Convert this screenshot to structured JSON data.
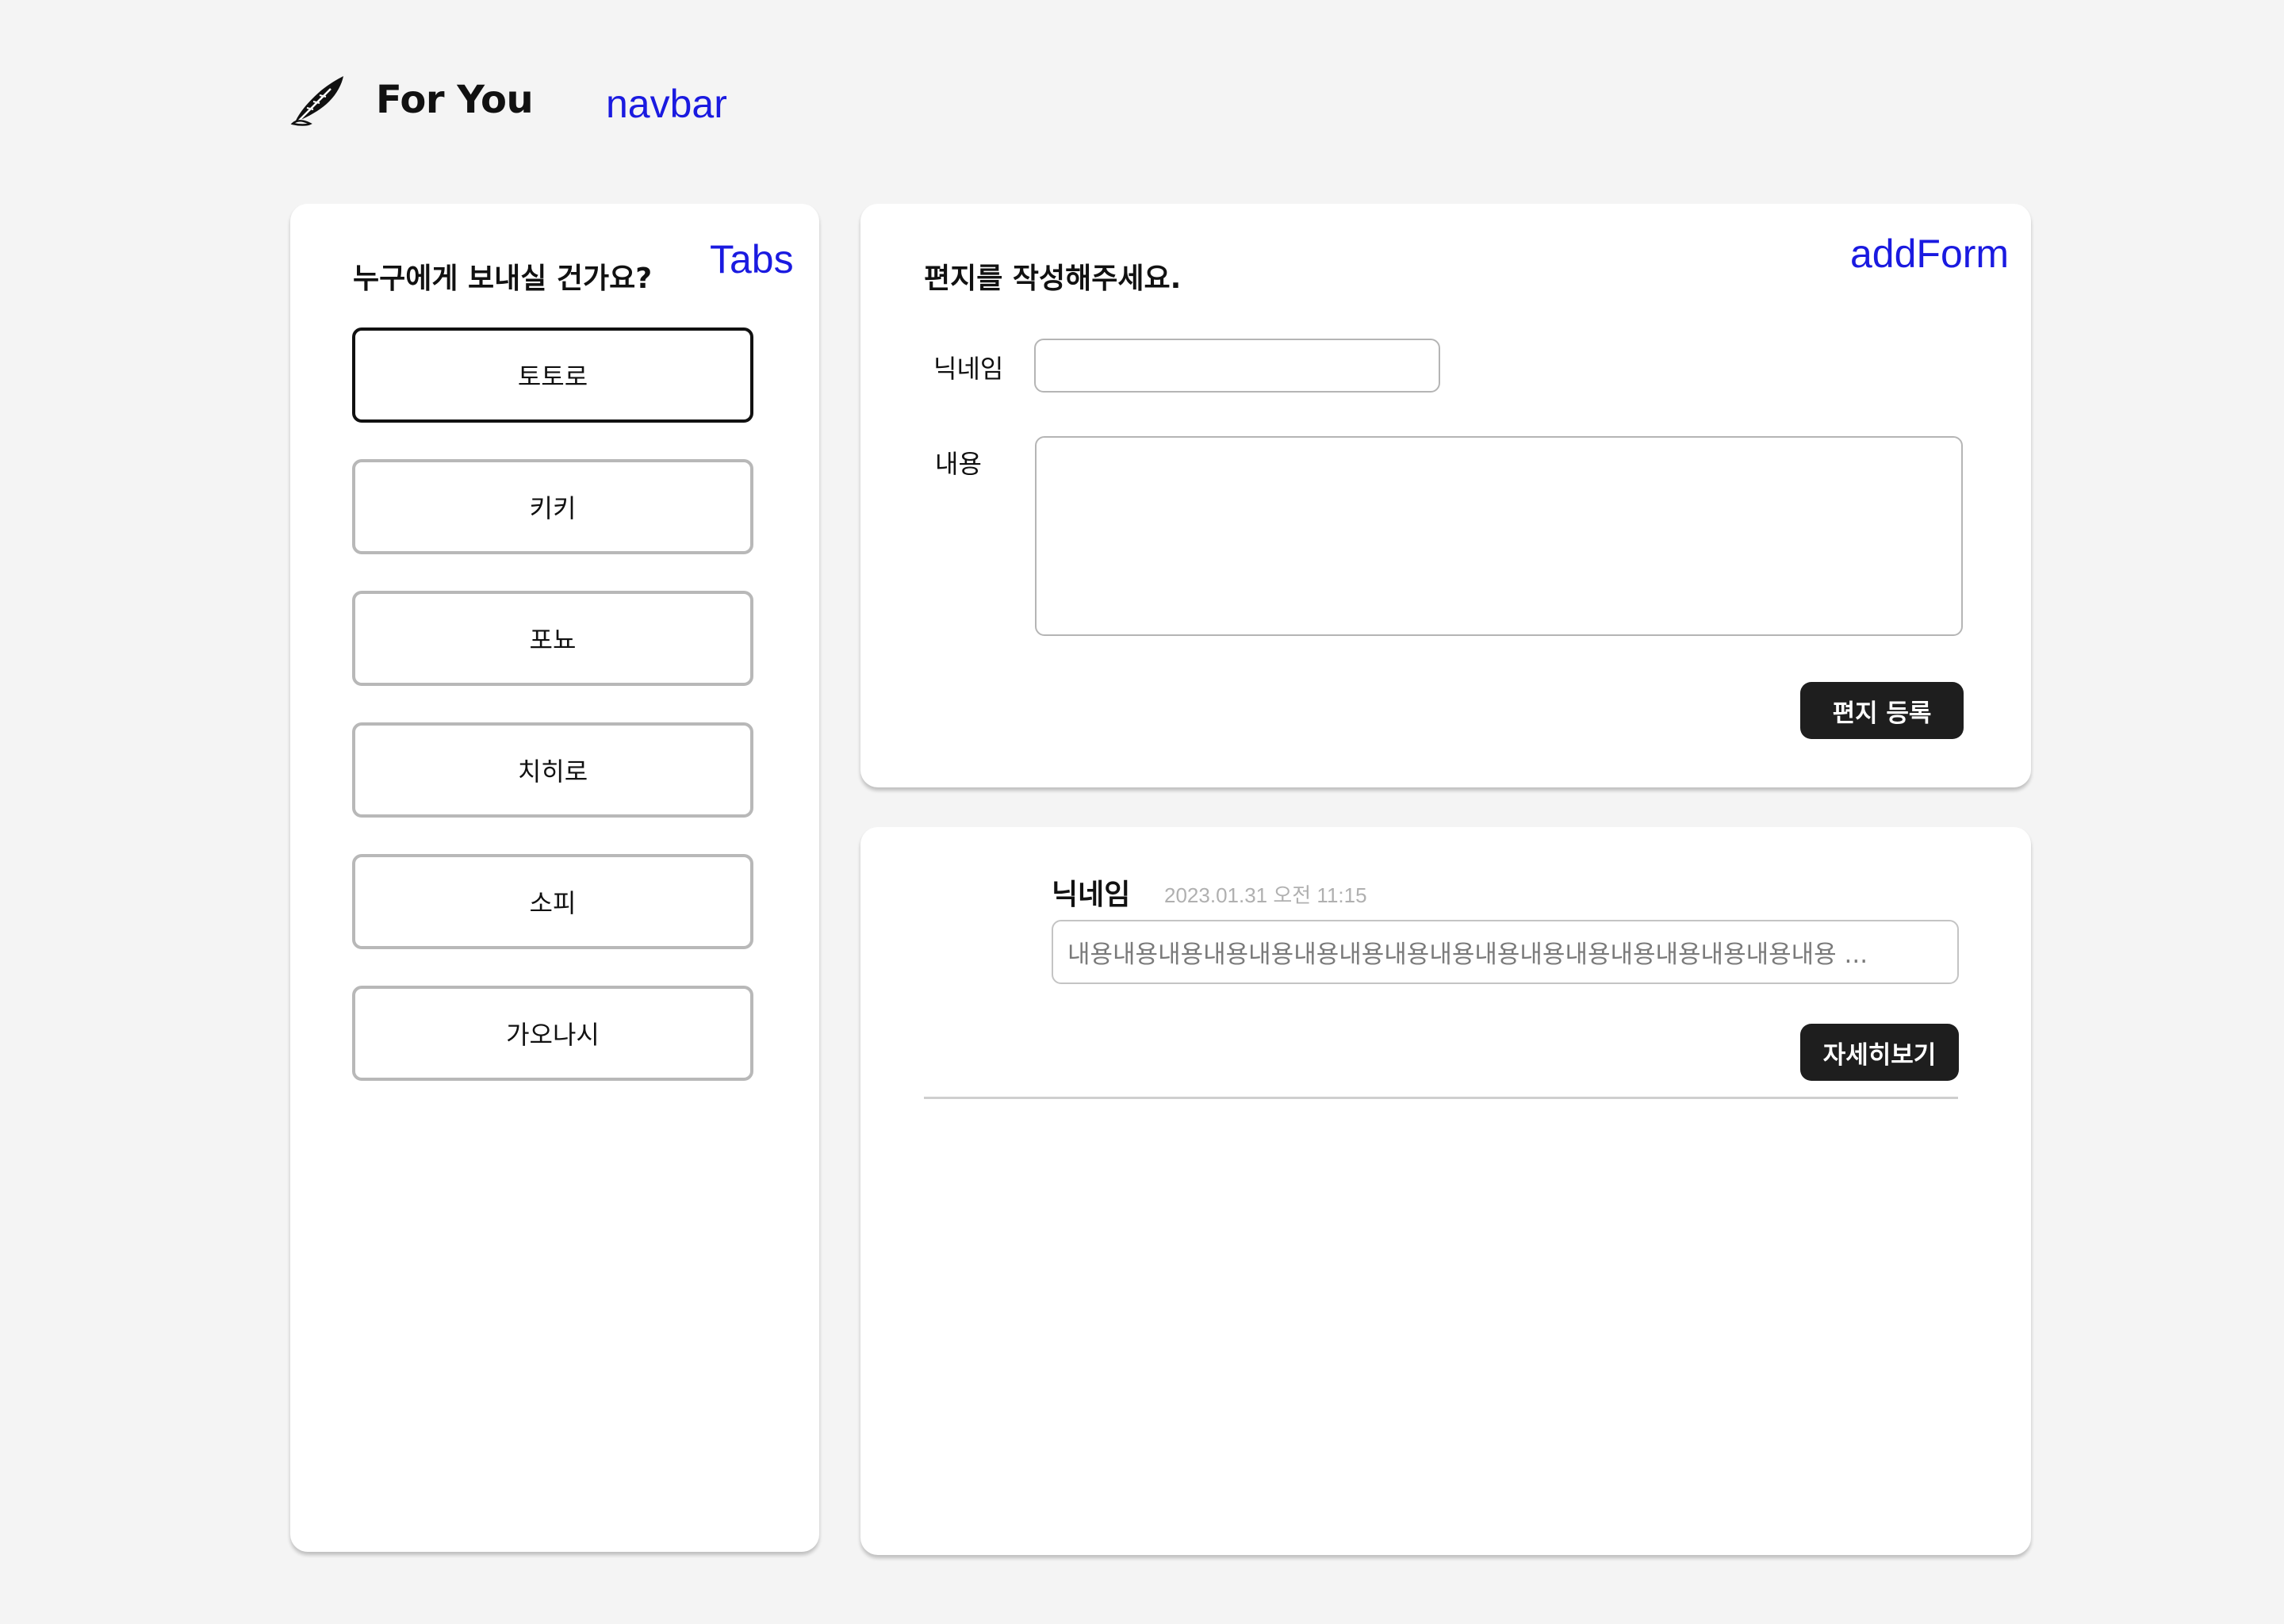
{
  "header": {
    "brand": "For You",
    "logo_icon": "quill-feather-icon",
    "navbar_label": "navbar"
  },
  "tabs": {
    "dev_label": "Tabs",
    "title": "누구에게 보내실 건가요?",
    "items": [
      {
        "label": "토토로",
        "active": true
      },
      {
        "label": "키키",
        "active": false
      },
      {
        "label": "포뇨",
        "active": false
      },
      {
        "label": "치히로",
        "active": false
      },
      {
        "label": "소피",
        "active": false
      },
      {
        "label": "가오나시",
        "active": false
      }
    ]
  },
  "form": {
    "dev_label": "addForm",
    "title": "편지를 작성해주세요.",
    "nickname_label": "닉네임",
    "nickname_value": "",
    "content_label": "내용",
    "content_value": "",
    "submit_label": "편지 등록"
  },
  "letters": [
    {
      "nickname": "닉네임",
      "timestamp": "2023.01.31 오전 11:15",
      "preview": "내용내용내용내용내용내용내용내용내용내용내용내용내용내용내용내용내용 ...",
      "detail_label": "자세히보기"
    }
  ],
  "colors": {
    "background": "#f4f4f4",
    "card": "#ffffff",
    "dark_button": "#1e1e1e",
    "dev_label": "#1a1ae0",
    "muted_text": "#b0b0b0"
  }
}
